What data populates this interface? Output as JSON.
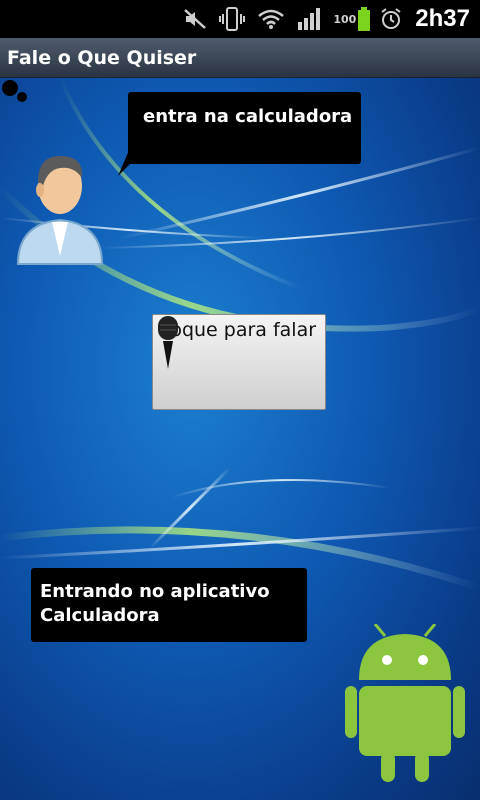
{
  "status_bar": {
    "battery_level": "100",
    "time": "2h37",
    "icons": [
      "mute-icon",
      "vibrate-icon",
      "wifi-icon",
      "signal-icon",
      "battery-icon",
      "alarm-icon"
    ]
  },
  "app": {
    "title": "Fale o Que Quiser"
  },
  "chat": {
    "user_message": "entra na calculadora",
    "bot_message_line1": "Entrando no aplicativo",
    "bot_message_line2": "Calculadora"
  },
  "talk_button": {
    "label": "Toque para falar",
    "icon": "microphone-icon"
  },
  "colors": {
    "bubble": "#000000",
    "wallpaper": "#0e58b1",
    "android_green": "#8cc63f"
  }
}
